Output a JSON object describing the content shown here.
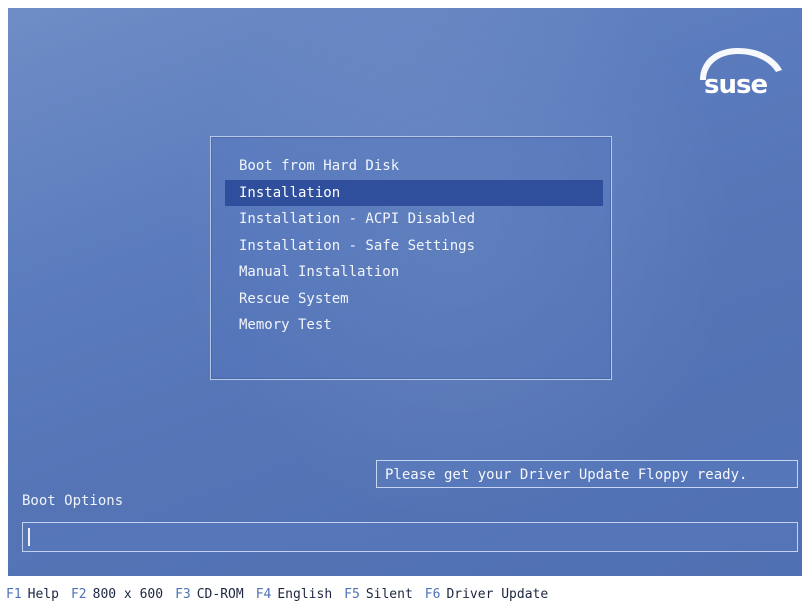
{
  "logo": {
    "text": "suse",
    "icon": "suse-chameleon-icon",
    "color": "#ffffff"
  },
  "menu": {
    "items": [
      {
        "label": "Boot from Hard Disk",
        "selected": false
      },
      {
        "label": "Installation",
        "selected": true
      },
      {
        "label": "Installation - ACPI Disabled",
        "selected": false
      },
      {
        "label": "Installation - Safe Settings",
        "selected": false
      },
      {
        "label": "Manual Installation",
        "selected": false
      },
      {
        "label": "Rescue System",
        "selected": false
      },
      {
        "label": "Memory Test",
        "selected": false
      }
    ],
    "selected_color": "#2f4f9d"
  },
  "notice": {
    "text": "Please get your Driver Update Floppy ready."
  },
  "boot_options": {
    "label": "Boot Options",
    "value": ""
  },
  "function_keys": [
    {
      "key": "F1",
      "label": "Help"
    },
    {
      "key": "F2",
      "label": "800 x 600"
    },
    {
      "key": "F3",
      "label": "CD-ROM"
    },
    {
      "key": "F4",
      "label": "English"
    },
    {
      "key": "F5",
      "label": "Silent"
    },
    {
      "key": "F6",
      "label": "Driver Update"
    }
  ],
  "colors": {
    "background": "#5a7bbd",
    "fkey_accent": "#4e73b8"
  }
}
